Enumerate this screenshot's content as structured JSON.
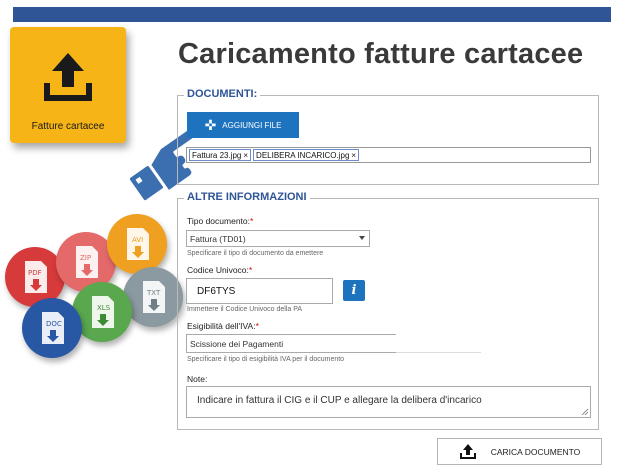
{
  "colors": {
    "header_bar": "#2f5597",
    "tile": "#f6b417",
    "primary": "#1e73be",
    "legend": "#2f5597"
  },
  "tile": {
    "label": "Fatture cartacee",
    "icon": "upload-icon"
  },
  "page": {
    "title": "Caricamento fatture cartacee"
  },
  "documenti": {
    "legend": "DOCUMENTI:",
    "add_button": "AGGIUNGI FILE",
    "files": [
      {
        "name": "Fattura 23.jpg",
        "remove": "×"
      },
      {
        "name": "DELIBERA INCARICO.jpg",
        "remove": "×"
      }
    ]
  },
  "altre": {
    "legend": "ALTRE INFORMAZIONI",
    "tipo": {
      "label": "Tipo documento:",
      "required": "*",
      "value": "Fattura (TD01)",
      "hint": "Specificare il tipo di documento da emettere"
    },
    "codice": {
      "label": "Codice Univoco:",
      "required": "*",
      "value": "DF6TYS",
      "info": "i",
      "hint": "Immettere il Codice Univoco della PA"
    },
    "esigibilita": {
      "label": "Esigibilità dell'IVA:",
      "required": "*",
      "value": "Scissione dei Pagamenti",
      "hint": "Specificare il tipo di esigibilità IVA per il documento"
    },
    "note": {
      "label": "Note:",
      "value": "Indicare in fattura il CIG e il CUP e allegare la delibera d'incarico"
    }
  },
  "upload_button": {
    "label": "CARICA DOCUMENTO"
  },
  "badges": [
    "PDF",
    "ZIP",
    "AVI",
    "TXT",
    "XLS",
    "DOC"
  ]
}
